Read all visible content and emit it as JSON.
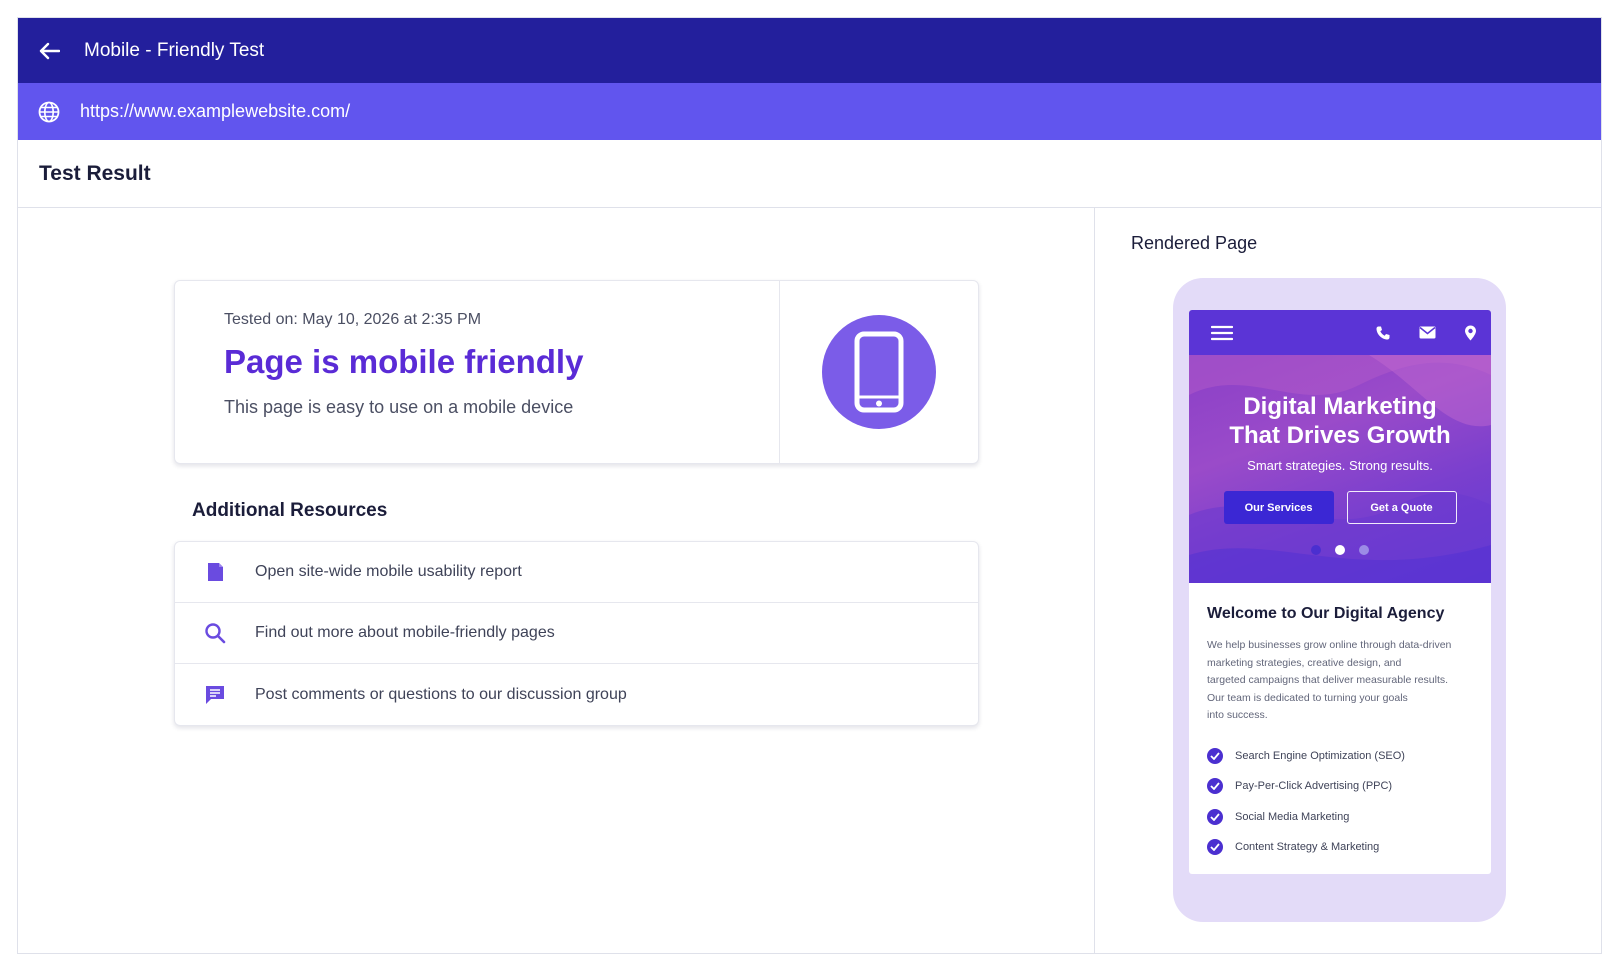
{
  "topbar": {
    "title": "Mobile - Friendly Test"
  },
  "urlbar": {
    "url": "https://www.examplewebsite.com/"
  },
  "result": {
    "title": "Test Result",
    "tested_on": "Tested on: May 10, 2026 at 2:35 PM",
    "headline": "Page is mobile friendly",
    "description": "This page is easy to use on a mobile device"
  },
  "resources": {
    "title": "Additional Resources",
    "items": [
      {
        "label": "Open site-wide mobile usability report",
        "icon": "report-icon"
      },
      {
        "label": "Find out more about mobile-friendly pages",
        "icon": "search-icon"
      },
      {
        "label": "Post comments or questions to our discussion group",
        "icon": "chat-icon"
      }
    ]
  },
  "rendered": {
    "title": "Rendered Page",
    "hero_line1": "Digital Marketing",
    "hero_line2": "That Drives Growth",
    "hero_sub": "Smart strategies. Strong results.",
    "btn_primary": "Our Services",
    "btn_secondary": "Get a Quote",
    "welcome_title": "Welcome to Our Digital Agency",
    "welcome_p1": "We help businesses grow online through data-driven",
    "welcome_p2": "marketing strategies, creative design, and",
    "welcome_p3": "targeted campaigns that deliver measurable results.",
    "welcome_p4": "Our team is dedicated to turning your goals",
    "welcome_p5": "into success.",
    "services": [
      "Search Engine Optimization (SEO)",
      "Pay-Per-Click Advertising (PPC)",
      "Social Media Marketing",
      "Content Strategy & Marketing"
    ]
  },
  "colors": {
    "topbar": "#231f9c",
    "urlbar": "#6155ee",
    "accent": "#5a2bd6",
    "phone_circle": "#7b5ce8"
  }
}
